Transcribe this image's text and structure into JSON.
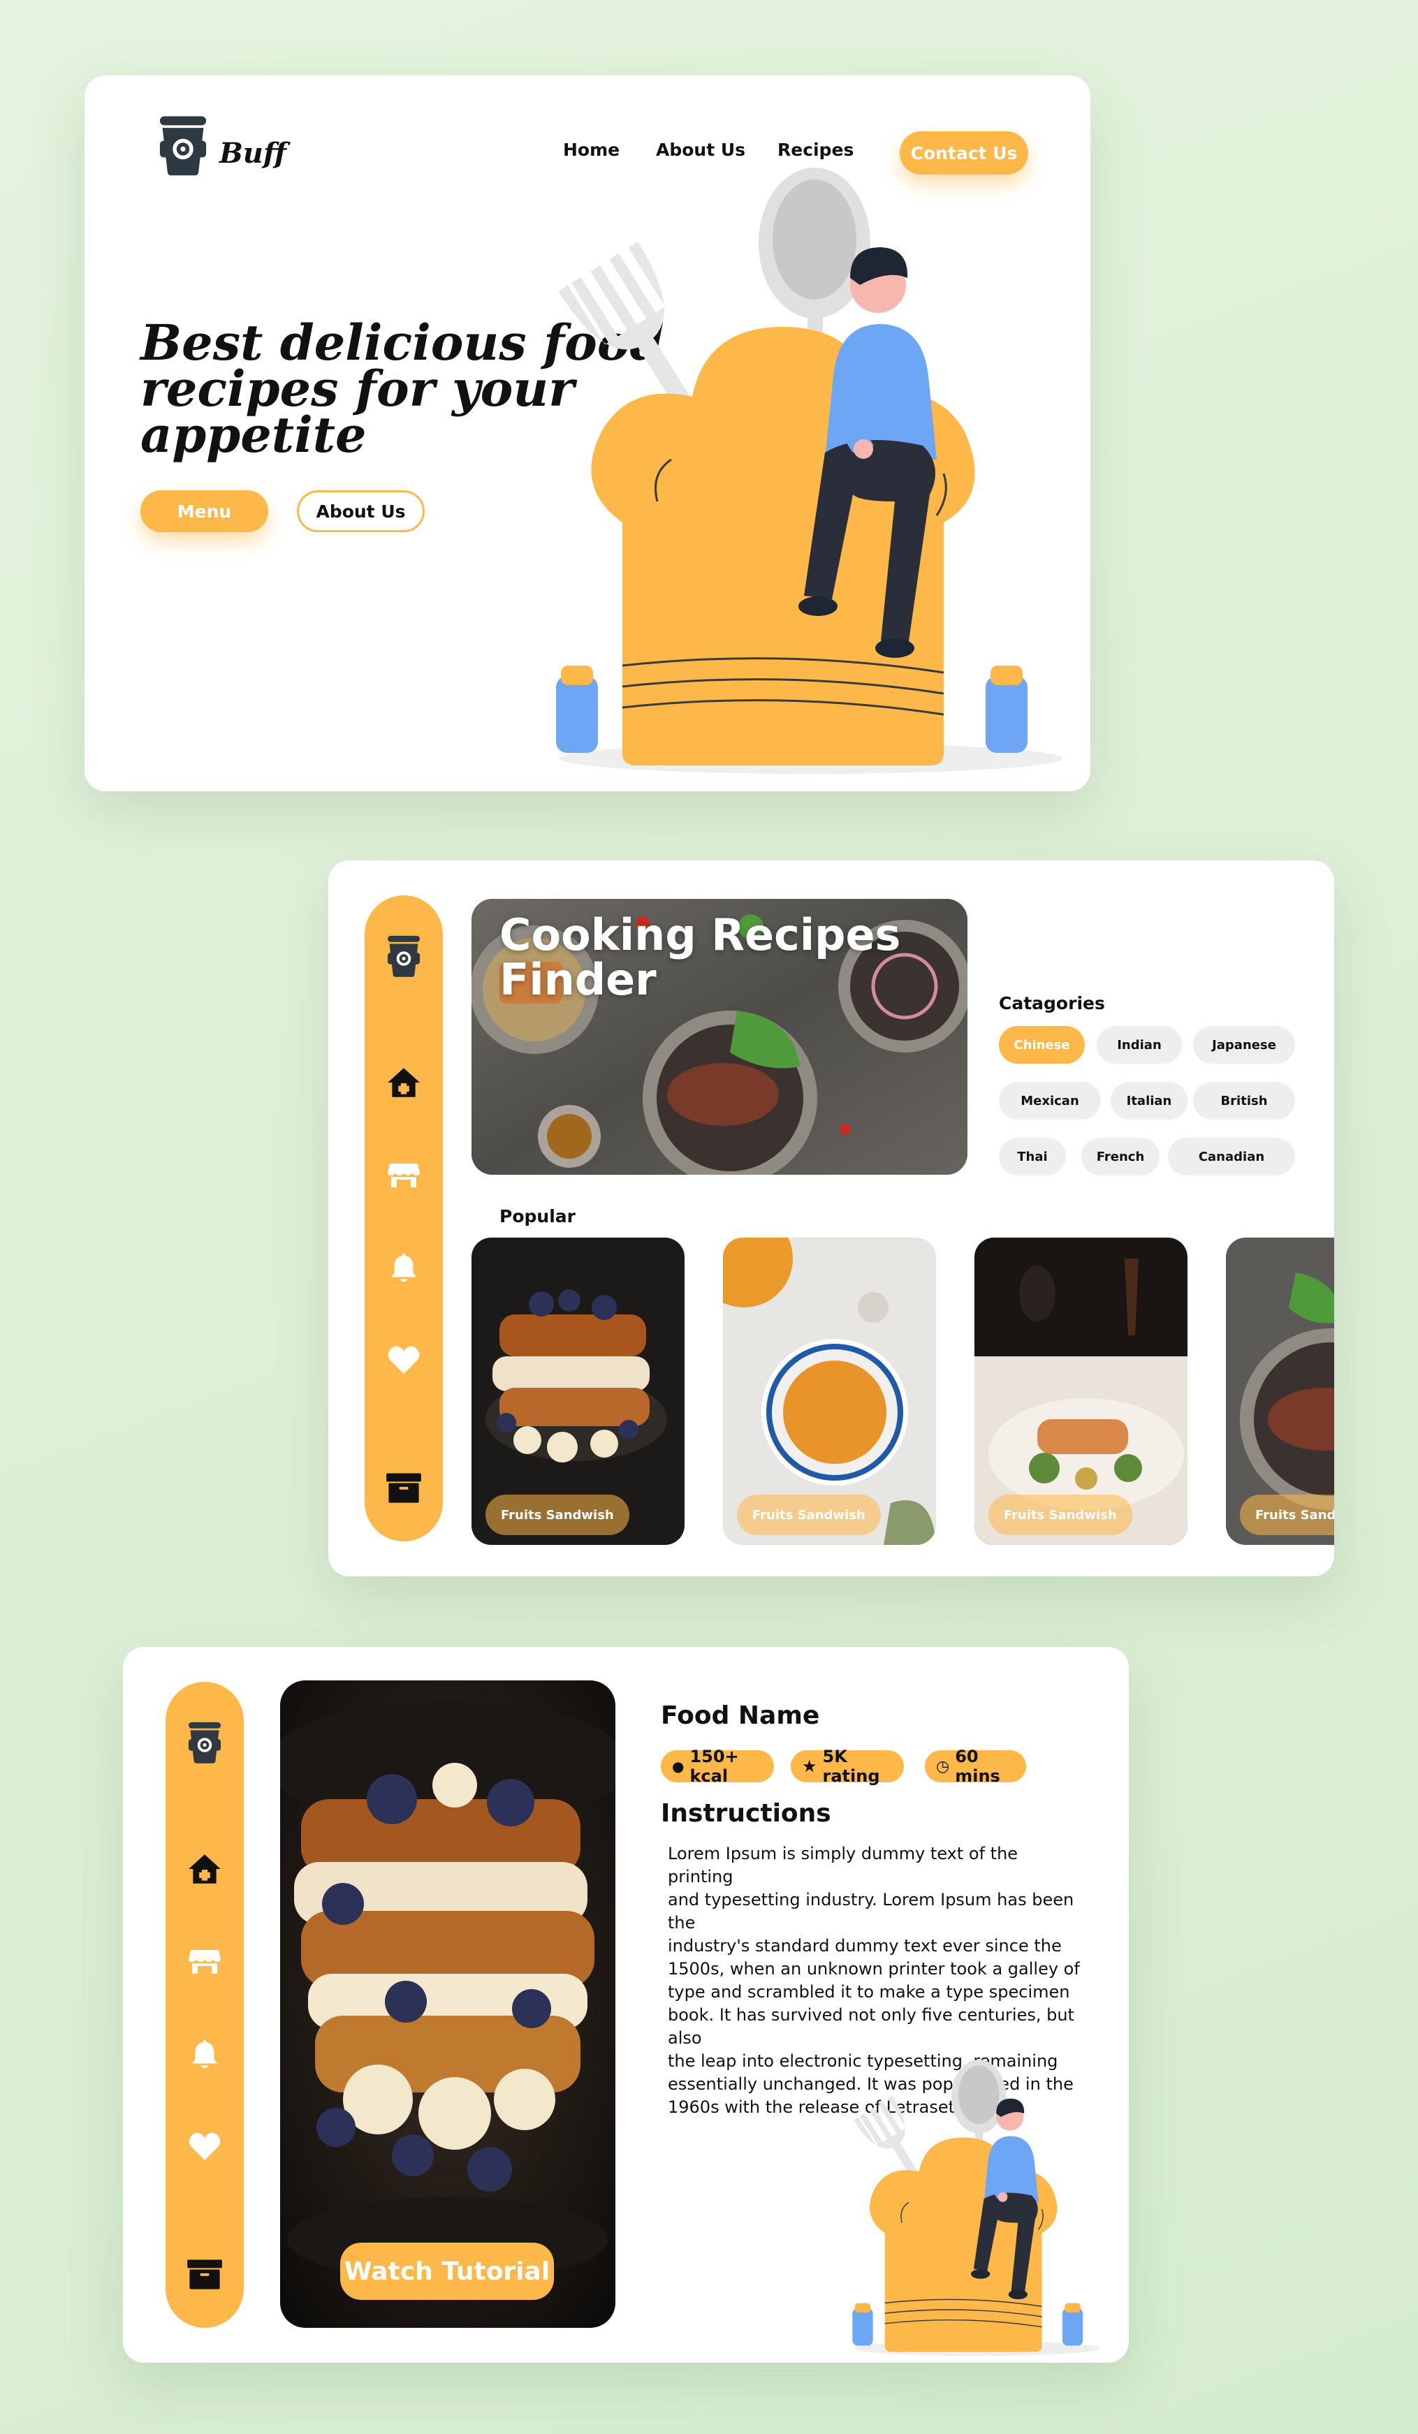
{
  "brand": {
    "name": "Buff"
  },
  "colors": {
    "accent": "#fdb849",
    "background": "#dcefd6",
    "card": "#ffffff",
    "dark": "#2f3942",
    "blue": "#6ca6f4"
  },
  "landing": {
    "nav": {
      "home": "Home",
      "about": "About Us",
      "recipes": "Recipes",
      "contact": "Contact Us"
    },
    "hero": {
      "title_line1": "Best delicious food",
      "title_line2": "recipes for your",
      "title_line3": "appetite"
    },
    "buttons": {
      "menu": "Menu",
      "about": "About Us"
    }
  },
  "finder": {
    "sidebar_icons": [
      "cup-logo-icon",
      "home-icon",
      "store-icon",
      "bell-icon",
      "heart-icon",
      "archive-icon"
    ],
    "banner": {
      "title_line1": "Cooking Recipes",
      "title_line2": "Finder"
    },
    "categories": {
      "heading": "Catagories",
      "items": [
        "Chinese",
        "Indian",
        "Japanese",
        "Mexican",
        "Italian",
        "British",
        "Thai",
        "French",
        "Canadian"
      ],
      "active": "Chinese"
    },
    "popular": {
      "heading": "Popular",
      "items": [
        {
          "label": "Fruits Sandwish"
        },
        {
          "label": "Fruits Sandwish"
        },
        {
          "label": "Fruits Sandwish"
        },
        {
          "label": "Fruits Sandwish"
        }
      ]
    }
  },
  "detail": {
    "watch_label": "Watch Tutorial",
    "food_name": "Food Name",
    "meta": {
      "kcal": "150+ kcal",
      "rating": "5K rating",
      "time": "60 mins"
    },
    "instructions_heading": "Instructions",
    "instructions_lines": [
      "Lorem Ipsum is simply dummy text of the printing",
      "and typesetting industry. Lorem Ipsum has been the",
      "industry's standard dummy text ever since the",
      "1500s, when an unknown printer took a galley of",
      "type and scrambled it to make a type specimen",
      "book. It has survived not only five centuries, but also",
      "the leap into electronic typesetting, remaining",
      "essentially unchanged. It was popularised in the",
      "1960s with the release of Letraset sheets"
    ]
  }
}
